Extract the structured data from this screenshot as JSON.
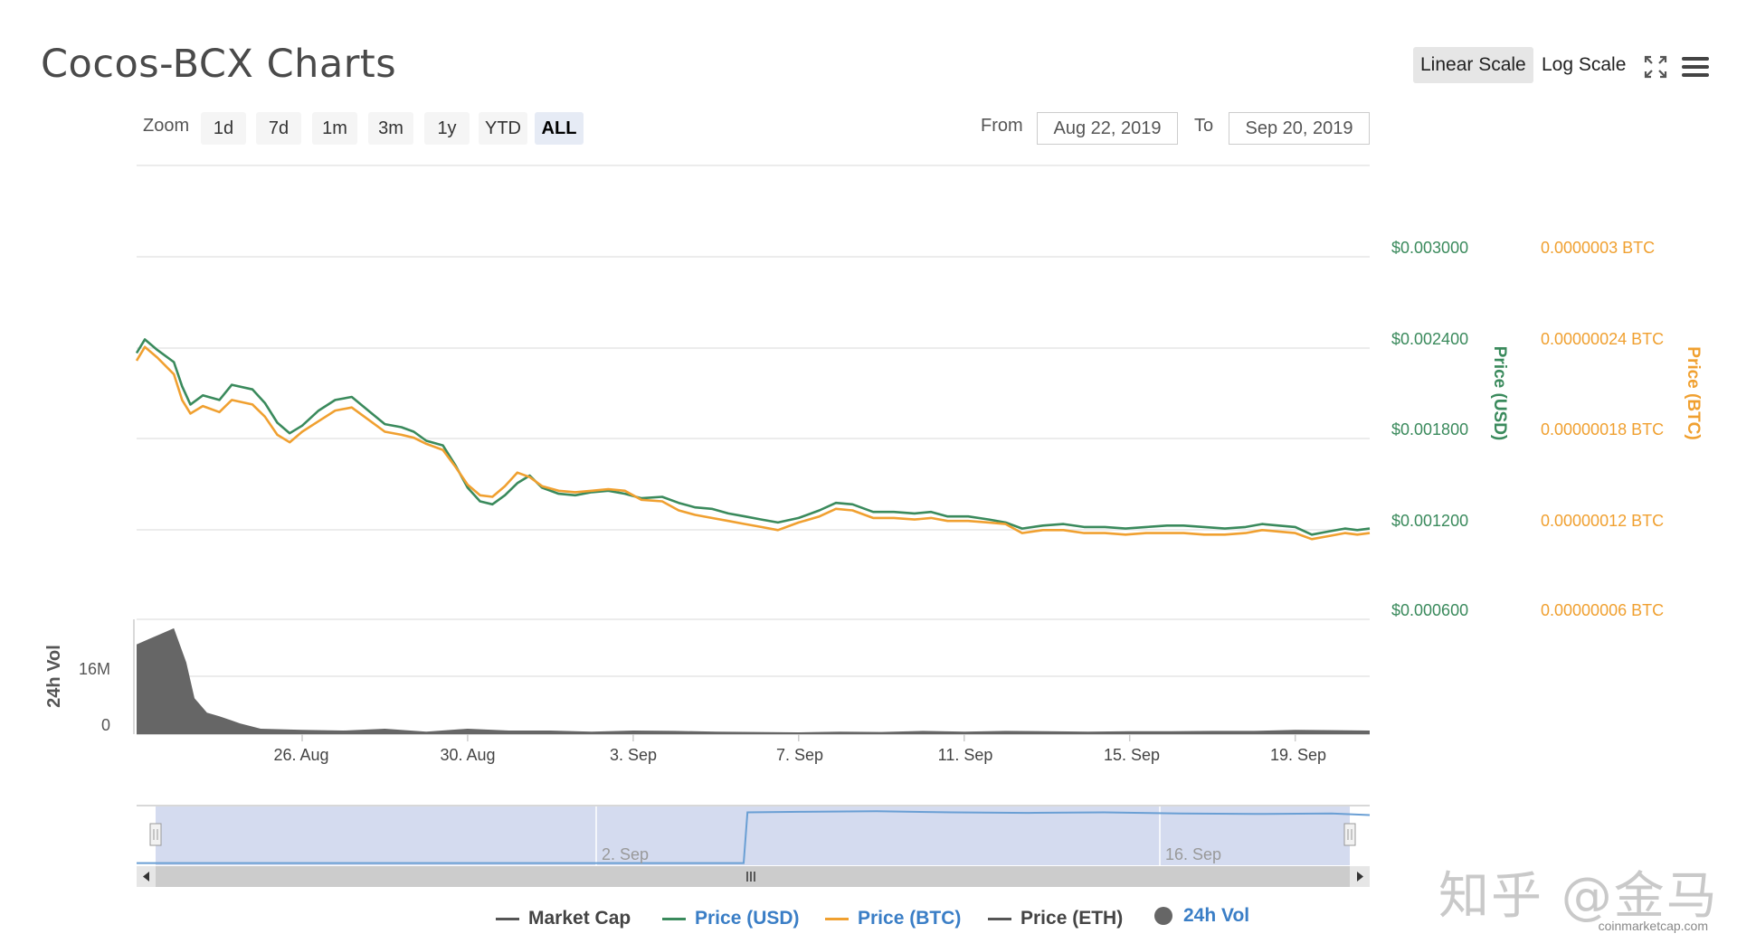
{
  "header": {
    "title": "Cocos-BCX Charts",
    "linear_scale": "Linear Scale",
    "log_scale": "Log Scale"
  },
  "zoom": {
    "label": "Zoom",
    "buttons": [
      "1d",
      "7d",
      "1m",
      "3m",
      "1y",
      "YTD",
      "ALL"
    ],
    "active": "ALL"
  },
  "range": {
    "from_label": "From",
    "from_value": "Aug 22, 2019",
    "to_label": "To",
    "to_value": "Sep 20, 2019"
  },
  "chart_data": {
    "type": "line",
    "x_tick_labels": [
      "26. Aug",
      "30. Aug",
      "3. Sep",
      "7. Sep",
      "11. Sep",
      "15. Sep",
      "19. Sep"
    ],
    "x_ticks_day": [
      26,
      30,
      34,
      38,
      42,
      46,
      50
    ],
    "x_range_day": [
      22,
      51.8
    ],
    "y_usd": {
      "label": "Price (USD)",
      "ticks": [
        "$0.003000",
        "$0.002400",
        "$0.001800",
        "$0.001200",
        "$0.000600"
      ],
      "tick_values": [
        0.003,
        0.0024,
        0.0018,
        0.0012,
        0.0006
      ],
      "range": [
        0.0006,
        0.0036
      ],
      "color": "#3a8a5c"
    },
    "y_btc": {
      "label": "Price (BTC)",
      "ticks": [
        "0.0000003 BTC",
        "0.00000024 BTC",
        "0.00000018 BTC",
        "0.00000012 BTC",
        "0.00000006 BTC"
      ],
      "tick_values": [
        3e-07,
        2.4e-07,
        1.8e-07,
        1.2e-07,
        6e-08
      ],
      "range": [
        6e-08,
        3.6e-07
      ],
      "color": "#f0a030"
    },
    "volume": {
      "label": "24h Vol",
      "ticks": [
        "16M",
        "0"
      ],
      "tick_values": [
        16000000,
        0
      ],
      "range": [
        0,
        32000000
      ],
      "color": "#666666"
    },
    "series": [
      {
        "name": "Price (USD)",
        "axis": "usd",
        "color": "#3a8a5c",
        "points": [
          [
            22.0,
            0.00236
          ],
          [
            22.2,
            0.00245
          ],
          [
            22.5,
            0.00238
          ],
          [
            22.9,
            0.0023
          ],
          [
            23.1,
            0.00214
          ],
          [
            23.3,
            0.00202
          ],
          [
            23.6,
            0.00208
          ],
          [
            24.0,
            0.00205
          ],
          [
            24.3,
            0.00215
          ],
          [
            24.8,
            0.00212
          ],
          [
            25.1,
            0.00203
          ],
          [
            25.4,
            0.0019
          ],
          [
            25.7,
            0.00183
          ],
          [
            26.0,
            0.00188
          ],
          [
            26.4,
            0.00198
          ],
          [
            26.8,
            0.00205
          ],
          [
            27.2,
            0.00207
          ],
          [
            27.6,
            0.00198
          ],
          [
            28.0,
            0.00189
          ],
          [
            28.4,
            0.00187
          ],
          [
            28.7,
            0.00184
          ],
          [
            29.0,
            0.00178
          ],
          [
            29.4,
            0.00175
          ],
          [
            29.7,
            0.00162
          ],
          [
            30.0,
            0.00147
          ],
          [
            30.3,
            0.00138
          ],
          [
            30.6,
            0.00136
          ],
          [
            30.9,
            0.00142
          ],
          [
            31.2,
            0.0015
          ],
          [
            31.5,
            0.00155
          ],
          [
            31.8,
            0.00147
          ],
          [
            32.2,
            0.00143
          ],
          [
            32.6,
            0.00142
          ],
          [
            33.0,
            0.00144
          ],
          [
            33.4,
            0.00145
          ],
          [
            33.8,
            0.00143
          ],
          [
            34.2,
            0.0014
          ],
          [
            34.7,
            0.00141
          ],
          [
            35.1,
            0.00137
          ],
          [
            35.5,
            0.00134
          ],
          [
            35.9,
            0.00133
          ],
          [
            36.3,
            0.0013
          ],
          [
            36.7,
            0.00128
          ],
          [
            37.1,
            0.00126
          ],
          [
            37.5,
            0.00124
          ],
          [
            38.0,
            0.00127
          ],
          [
            38.5,
            0.00132
          ],
          [
            38.9,
            0.00137
          ],
          [
            39.3,
            0.00136
          ],
          [
            39.8,
            0.00131
          ],
          [
            40.3,
            0.00131
          ],
          [
            40.8,
            0.0013
          ],
          [
            41.2,
            0.00131
          ],
          [
            41.6,
            0.00128
          ],
          [
            42.1,
            0.00128
          ],
          [
            42.6,
            0.00126
          ],
          [
            43.0,
            0.00124
          ],
          [
            43.4,
            0.0012
          ],
          [
            43.9,
            0.00122
          ],
          [
            44.4,
            0.00123
          ],
          [
            44.9,
            0.00121
          ],
          [
            45.4,
            0.00121
          ],
          [
            45.9,
            0.0012
          ],
          [
            46.4,
            0.00121
          ],
          [
            46.9,
            0.00122
          ],
          [
            47.3,
            0.00122
          ],
          [
            47.8,
            0.00121
          ],
          [
            48.3,
            0.0012
          ],
          [
            48.8,
            0.00121
          ],
          [
            49.2,
            0.00123
          ],
          [
            49.6,
            0.00122
          ],
          [
            50.0,
            0.00121
          ],
          [
            50.4,
            0.00116
          ],
          [
            50.8,
            0.00118
          ],
          [
            51.2,
            0.0012
          ],
          [
            51.5,
            0.00119
          ],
          [
            51.8,
            0.0012
          ]
        ]
      },
      {
        "name": "Price (BTC)",
        "axis": "btc",
        "color": "#f0a030",
        "points": [
          [
            22.0,
            2.31e-07
          ],
          [
            22.2,
            2.4e-07
          ],
          [
            22.5,
            2.33e-07
          ],
          [
            22.9,
            2.22e-07
          ],
          [
            23.1,
            2.05e-07
          ],
          [
            23.3,
            1.96e-07
          ],
          [
            23.6,
            2.01e-07
          ],
          [
            24.0,
            1.97e-07
          ],
          [
            24.3,
            2.05e-07
          ],
          [
            24.8,
            2.02e-07
          ],
          [
            25.1,
            1.94e-07
          ],
          [
            25.4,
            1.82e-07
          ],
          [
            25.7,
            1.77e-07
          ],
          [
            26.0,
            1.84e-07
          ],
          [
            26.4,
            1.91e-07
          ],
          [
            26.8,
            1.98e-07
          ],
          [
            27.2,
            2e-07
          ],
          [
            27.6,
            1.92e-07
          ],
          [
            28.0,
            1.84e-07
          ],
          [
            28.4,
            1.82e-07
          ],
          [
            28.7,
            1.8e-07
          ],
          [
            29.0,
            1.76e-07
          ],
          [
            29.4,
            1.72e-07
          ],
          [
            29.7,
            1.61e-07
          ],
          [
            30.0,
            1.49e-07
          ],
          [
            30.3,
            1.42e-07
          ],
          [
            30.6,
            1.41e-07
          ],
          [
            30.9,
            1.48e-07
          ],
          [
            31.2,
            1.57e-07
          ],
          [
            31.5,
            1.54e-07
          ],
          [
            31.8,
            1.48e-07
          ],
          [
            32.2,
            1.45e-07
          ],
          [
            32.6,
            1.44e-07
          ],
          [
            33.0,
            1.45e-07
          ],
          [
            33.4,
            1.46e-07
          ],
          [
            33.8,
            1.45e-07
          ],
          [
            34.2,
            1.39e-07
          ],
          [
            34.7,
            1.38e-07
          ],
          [
            35.1,
            1.32e-07
          ],
          [
            35.5,
            1.29e-07
          ],
          [
            35.9,
            1.27e-07
          ],
          [
            36.3,
            1.25e-07
          ],
          [
            36.7,
            1.23e-07
          ],
          [
            37.1,
            1.21e-07
          ],
          [
            37.5,
            1.19e-07
          ],
          [
            38.0,
            1.24e-07
          ],
          [
            38.5,
            1.28e-07
          ],
          [
            38.9,
            1.33e-07
          ],
          [
            39.3,
            1.32e-07
          ],
          [
            39.8,
            1.27e-07
          ],
          [
            40.3,
            1.27e-07
          ],
          [
            40.8,
            1.26e-07
          ],
          [
            41.2,
            1.27e-07
          ],
          [
            41.6,
            1.25e-07
          ],
          [
            42.1,
            1.25e-07
          ],
          [
            42.6,
            1.24e-07
          ],
          [
            43.0,
            1.23e-07
          ],
          [
            43.4,
            1.17e-07
          ],
          [
            43.9,
            1.19e-07
          ],
          [
            44.4,
            1.19e-07
          ],
          [
            44.9,
            1.17e-07
          ],
          [
            45.4,
            1.17e-07
          ],
          [
            45.9,
            1.16e-07
          ],
          [
            46.4,
            1.17e-07
          ],
          [
            46.9,
            1.17e-07
          ],
          [
            47.3,
            1.17e-07
          ],
          [
            47.8,
            1.16e-07
          ],
          [
            48.3,
            1.16e-07
          ],
          [
            48.8,
            1.17e-07
          ],
          [
            49.2,
            1.19e-07
          ],
          [
            49.6,
            1.18e-07
          ],
          [
            50.0,
            1.17e-07
          ],
          [
            50.4,
            1.13e-07
          ],
          [
            50.8,
            1.15e-07
          ],
          [
            51.2,
            1.17e-07
          ],
          [
            51.5,
            1.16e-07
          ],
          [
            51.8,
            1.17e-07
          ]
        ]
      }
    ],
    "volume_points": [
      [
        22.0,
        25000000
      ],
      [
        22.3,
        26500000
      ],
      [
        22.6,
        28000000
      ],
      [
        22.9,
        29500000
      ],
      [
        23.2,
        20000000
      ],
      [
        23.4,
        10000000
      ],
      [
        23.7,
        6000000
      ],
      [
        24.0,
        5000000
      ],
      [
        24.5,
        3000000
      ],
      [
        25.0,
        1500000
      ],
      [
        26.0,
        1200000
      ],
      [
        27.0,
        1000000
      ],
      [
        28.0,
        1500000
      ],
      [
        29.0,
        700000
      ],
      [
        30.0,
        1500000
      ],
      [
        31.0,
        1000000
      ],
      [
        32.0,
        1000000
      ],
      [
        33.0,
        700000
      ],
      [
        34.0,
        1000000
      ],
      [
        35.0,
        900000
      ],
      [
        36.0,
        700000
      ],
      [
        37.0,
        600000
      ],
      [
        38.0,
        500000
      ],
      [
        39.0,
        700000
      ],
      [
        40.0,
        600000
      ],
      [
        41.0,
        900000
      ],
      [
        42.0,
        700000
      ],
      [
        43.0,
        900000
      ],
      [
        44.0,
        800000
      ],
      [
        45.0,
        700000
      ],
      [
        46.0,
        800000
      ],
      [
        47.0,
        800000
      ],
      [
        48.0,
        900000
      ],
      [
        49.0,
        900000
      ],
      [
        50.0,
        1200000
      ],
      [
        51.0,
        1100000
      ],
      [
        51.8,
        1000000
      ]
    ],
    "navigator": {
      "labels": [
        "2. Sep",
        "16. Sep"
      ],
      "label_days": [
        33,
        47
      ],
      "points": [
        [
          20.5,
          0.2
        ],
        [
          25.0,
          0.2
        ],
        [
          30.0,
          0.2
        ],
        [
          36.5,
          0.2
        ],
        [
          36.6,
          4.95
        ],
        [
          38.0,
          5.0
        ],
        [
          40.0,
          5.05
        ],
        [
          42.0,
          4.95
        ],
        [
          44.0,
          4.9
        ],
        [
          46.0,
          4.95
        ],
        [
          48.0,
          4.85
        ],
        [
          50.0,
          4.8
        ],
        [
          52.0,
          4.85
        ],
        [
          53.0,
          4.7
        ]
      ]
    }
  },
  "legend": {
    "items": [
      {
        "label": "Market Cap",
        "color": "#555555",
        "shape": "line"
      },
      {
        "label": "Price (USD)",
        "color": "#3a8a5c",
        "shape": "line"
      },
      {
        "label": "Price (BTC)",
        "color": "#f0a030",
        "shape": "line"
      },
      {
        "label": "Price (ETH)",
        "color": "#555555",
        "shape": "line"
      },
      {
        "label": "24h Vol",
        "color": "#666666",
        "shape": "dot"
      }
    ]
  },
  "credit": "coinmarketcap.com",
  "watermark": "知乎 @金马"
}
